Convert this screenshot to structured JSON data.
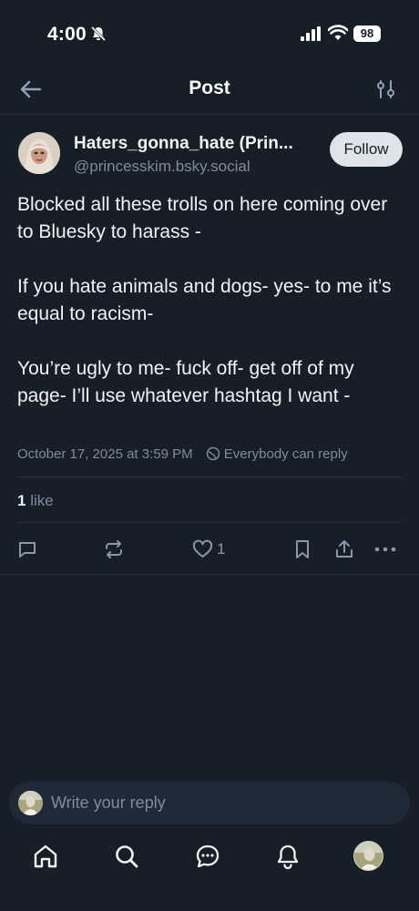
{
  "status_bar": {
    "time": "4:00",
    "battery": "98"
  },
  "header": {
    "title": "Post"
  },
  "author": {
    "display_name": "Haters_gonna_hate (Prin...",
    "handle": "@princesskim.bsky.social",
    "follow_label": "Follow"
  },
  "post": {
    "paragraphs": [
      "Blocked all these trolls on here coming over to Bluesky to harass -",
      "If you hate animals and dogs- yes- to me it’s equal to racism-",
      "You’re ugly to me- fuck off- get off of my page- I’ll use whatever hashtag I want -"
    ],
    "timestamp": "October 17, 2025 at 3:59 PM",
    "reply_permission": "Everybody can reply",
    "likes_count": "1",
    "likes_label": "like",
    "action_like_count": "1"
  },
  "reply_box": {
    "placeholder": "Write your reply"
  },
  "icons": {
    "back": "arrow-left-icon",
    "settings": "sliders-icon",
    "reply": "comment-icon",
    "repost": "repost-icon",
    "like": "heart-icon",
    "bookmark": "bookmark-icon",
    "share": "share-icon",
    "more": "ellipsis-icon",
    "home": "home-icon",
    "search": "search-icon",
    "chat": "chat-icon",
    "notifications": "bell-icon"
  },
  "colors": {
    "background": "#161e27",
    "muted": "#7f8c9a",
    "accent_gray": "#dfe4ea"
  }
}
